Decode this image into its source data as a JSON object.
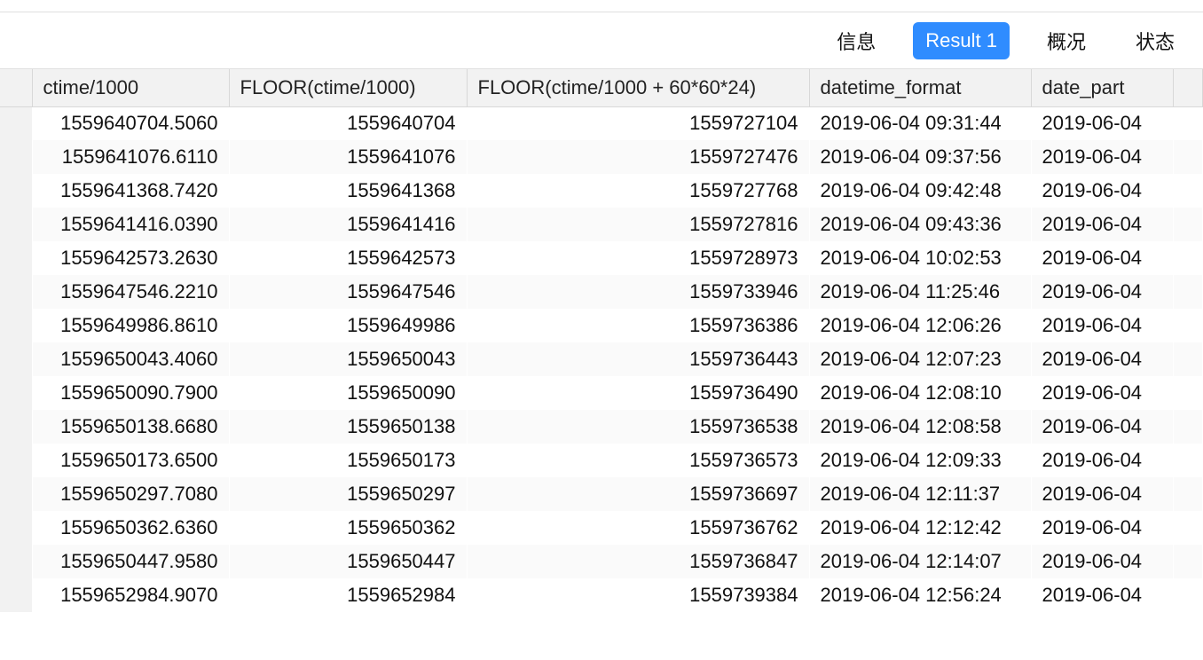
{
  "tabs": {
    "info": "信息",
    "result1": "Result 1",
    "overview": "概况",
    "status": "状态",
    "active": "result1"
  },
  "columns": [
    {
      "key": "ctime",
      "label": "ctime/1000",
      "align": "right",
      "cls": "col-ctime"
    },
    {
      "key": "floor1",
      "label": "FLOOR(ctime/1000)",
      "align": "right",
      "cls": "col-floor1"
    },
    {
      "key": "floor2",
      "label": "FLOOR(ctime/1000 + 60*60*24)",
      "align": "right",
      "cls": "col-floor2"
    },
    {
      "key": "dtf",
      "label": "datetime_format",
      "align": "left",
      "cls": "col-dtf"
    },
    {
      "key": "dp",
      "label": "date_part",
      "align": "left",
      "cls": "col-dp"
    }
  ],
  "rows": [
    {
      "ctime": "1559640704.5060",
      "floor1": "1559640704",
      "floor2": "1559727104",
      "dtf": "2019-06-04 09:31:44",
      "dp": "2019-06-04"
    },
    {
      "ctime": "1559641076.6110",
      "floor1": "1559641076",
      "floor2": "1559727476",
      "dtf": "2019-06-04 09:37:56",
      "dp": "2019-06-04"
    },
    {
      "ctime": "1559641368.7420",
      "floor1": "1559641368",
      "floor2": "1559727768",
      "dtf": "2019-06-04 09:42:48",
      "dp": "2019-06-04"
    },
    {
      "ctime": "1559641416.0390",
      "floor1": "1559641416",
      "floor2": "1559727816",
      "dtf": "2019-06-04 09:43:36",
      "dp": "2019-06-04"
    },
    {
      "ctime": "1559642573.2630",
      "floor1": "1559642573",
      "floor2": "1559728973",
      "dtf": "2019-06-04 10:02:53",
      "dp": "2019-06-04"
    },
    {
      "ctime": "1559647546.2210",
      "floor1": "1559647546",
      "floor2": "1559733946",
      "dtf": "2019-06-04 11:25:46",
      "dp": "2019-06-04"
    },
    {
      "ctime": "1559649986.8610",
      "floor1": "1559649986",
      "floor2": "1559736386",
      "dtf": "2019-06-04 12:06:26",
      "dp": "2019-06-04"
    },
    {
      "ctime": "1559650043.4060",
      "floor1": "1559650043",
      "floor2": "1559736443",
      "dtf": "2019-06-04 12:07:23",
      "dp": "2019-06-04"
    },
    {
      "ctime": "1559650090.7900",
      "floor1": "1559650090",
      "floor2": "1559736490",
      "dtf": "2019-06-04 12:08:10",
      "dp": "2019-06-04"
    },
    {
      "ctime": "1559650138.6680",
      "floor1": "1559650138",
      "floor2": "1559736538",
      "dtf": "2019-06-04 12:08:58",
      "dp": "2019-06-04"
    },
    {
      "ctime": "1559650173.6500",
      "floor1": "1559650173",
      "floor2": "1559736573",
      "dtf": "2019-06-04 12:09:33",
      "dp": "2019-06-04"
    },
    {
      "ctime": "1559650297.7080",
      "floor1": "1559650297",
      "floor2": "1559736697",
      "dtf": "2019-06-04 12:11:37",
      "dp": "2019-06-04"
    },
    {
      "ctime": "1559650362.6360",
      "floor1": "1559650362",
      "floor2": "1559736762",
      "dtf": "2019-06-04 12:12:42",
      "dp": "2019-06-04"
    },
    {
      "ctime": "1559650447.9580",
      "floor1": "1559650447",
      "floor2": "1559736847",
      "dtf": "2019-06-04 12:14:07",
      "dp": "2019-06-04"
    },
    {
      "ctime": "1559652984.9070",
      "floor1": "1559652984",
      "floor2": "1559739384",
      "dtf": "2019-06-04 12:56:24",
      "dp": "2019-06-04"
    }
  ]
}
